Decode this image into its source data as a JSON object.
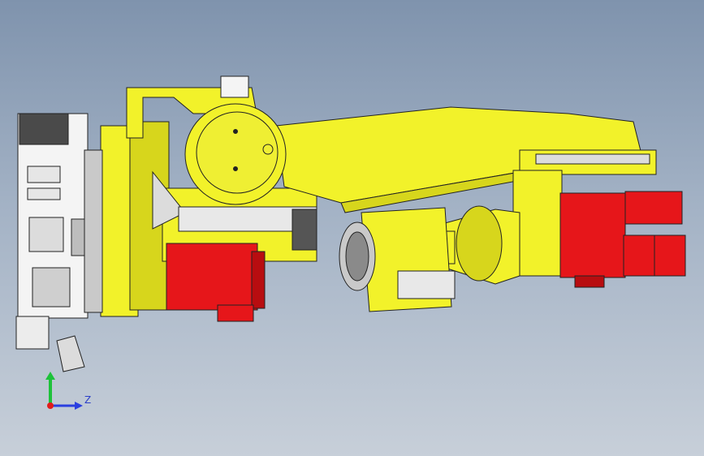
{
  "viewport": {
    "background_top": "#7f93ad",
    "background_bottom": "#c7cfd9"
  },
  "model": {
    "colors": {
      "yellow": "#f2f22a",
      "yellow_shade": "#d7d61c",
      "red": "#e6161a",
      "red_shade": "#b80d10",
      "gray": "#c9c9c9",
      "dark": "#3a3a3a",
      "white": "#f4f4f4"
    }
  },
  "triad": {
    "axis_z_label": "Z",
    "colors": {
      "x": "#e21b1b",
      "y": "#1ec23a",
      "z": "#2a3fe0"
    }
  }
}
